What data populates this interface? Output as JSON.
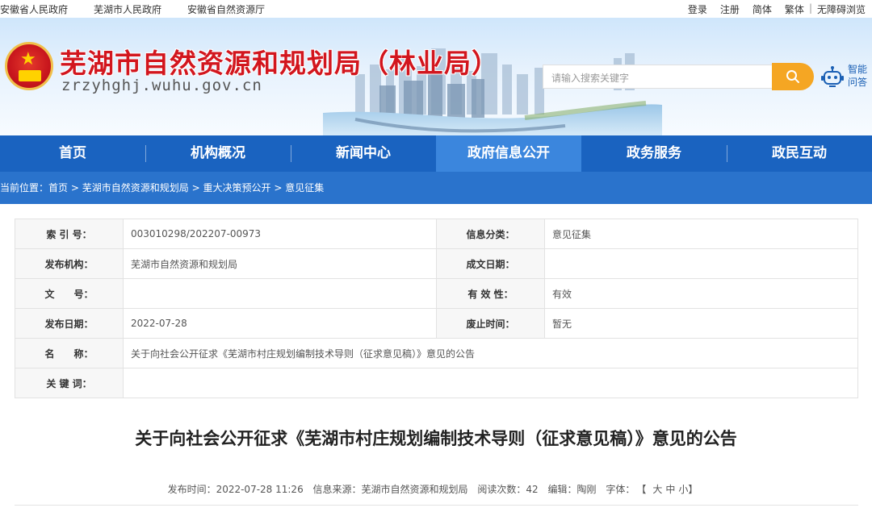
{
  "topbar": {
    "gov_links": [
      "安徽省人民政府",
      "芜湖市人民政府",
      "安徽省自然资源厅"
    ],
    "login": "登录",
    "register": "注册",
    "simplified": "简体",
    "traditional": "繁体",
    "divider": "|",
    "accessible": "无障碍浏览"
  },
  "header": {
    "title": "芜湖市自然资源和规划局（林业局）",
    "domain": "zrzyhghj.wuhu.gov.cn",
    "search_placeholder": "请输入搜索关键字",
    "qa_label": "智能问答",
    "emblem_icon": "national-emblem-icon",
    "colors": {
      "title_red": "#d2161e",
      "search_orange": "#f5a623",
      "nav_blue": "#1a63c0"
    }
  },
  "nav": {
    "items": [
      "首页",
      "机构概况",
      "新闻中心",
      "政府信息公开",
      "政务服务",
      "政民互动"
    ],
    "active": "政府信息公开"
  },
  "breadcrumb": {
    "label": "当前位置：",
    "items": [
      "首页",
      "芜湖市自然资源和规划局",
      "重大决策预公开",
      "意见征集"
    ],
    "sep": ">"
  },
  "meta": {
    "index_label": "索 引 号：",
    "index_value": "003010298/202207-00973",
    "category_label": "信息分类：",
    "category_value": "意见征集",
    "publisher_label": "发布机构：",
    "publisher_value": "芜湖市自然资源和规划局",
    "created_label": "成文日期：",
    "created_value": "",
    "docno_label": "文　　号：",
    "docno_value": "",
    "validity_label": "有 效 性：",
    "validity_value": "有效",
    "pubdate_label": "发布日期：",
    "pubdate_value": "2022-07-28",
    "expiry_label": "废止时间：",
    "expiry_value": "暂无",
    "name_label": "名　　称：",
    "name_value": "关于向社会公开征求《芜湖市村庄规划编制技术导则（征求意见稿）》意见的公告",
    "keywords_label": "关 键 词：",
    "keywords_value": ""
  },
  "article": {
    "title": "关于向社会公开征求《芜湖市村庄规划编制技术导则（征求意见稿）》意见的公告",
    "time": "发布时间：2022-07-28 11:26",
    "source": "信息来源：芜湖市自然资源和规划局",
    "reads": "阅读次数：42",
    "editor": "编辑：陶刚",
    "font_label": "字体：",
    "font_open": "【",
    "font_large": "大",
    "font_medium": "中",
    "font_small": "小",
    "font_close": "】"
  }
}
